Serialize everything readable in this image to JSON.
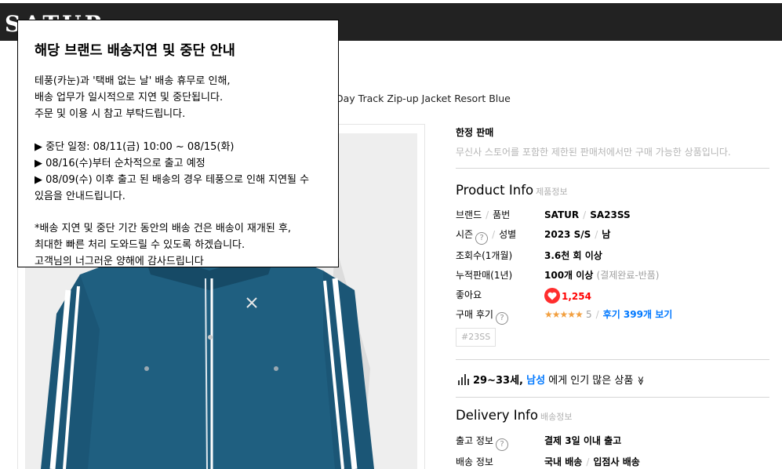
{
  "header": {
    "brand_logo": "SATUR"
  },
  "product": {
    "name": "Day Track Zip-up Jacket Resort Blue"
  },
  "limited": {
    "title": "한정 판매",
    "desc": "무신사 스토어를 포함한 제한된 판매처에서만 구매 가능한 상품입니다."
  },
  "product_info": {
    "title": "Product Info",
    "sub": "제품정보",
    "brand_label": "브랜드",
    "sku_label": "품번",
    "brand_value": "SATUR",
    "sku_value": "SA23SS",
    "season_label": "시즌",
    "gender_label": "성별",
    "season_value": "2023 S/S",
    "gender_value": "남",
    "views_label": "조회수(1개월)",
    "views_value": "3.6천 회 이상",
    "sales_label": "누적판매(1년)",
    "sales_value": "100개 이상",
    "sales_note": "(결제완료-반품)",
    "likes_label": "좋아요",
    "likes_value": "1,254",
    "review_label": "구매 후기",
    "review_stars": "★★★★★",
    "review_score": "5",
    "review_link": "후기 399개 보기",
    "qmark": "?",
    "tag": "#23SS"
  },
  "popular": {
    "age": "29~33세",
    "comma": ",",
    "gender": "남성",
    "text": "에게 인기 많은 상품",
    "chevron": "≫"
  },
  "delivery_info": {
    "title": "Delivery Info",
    "sub": "배송정보",
    "ship_label": "출고 정보",
    "ship_value": "결제 3일 이내 출고",
    "delivery_label": "배송 정보",
    "delivery_value_1": "국내 배송",
    "delivery_value_2": "입점사 배송"
  },
  "notice_modal": {
    "title": "해당 브랜드 배송지연 및 중단 안내",
    "lines": [
      "테풍(카눈)과 '택배 없는 날' 배송 휴무로 인해,",
      "배송 업무가 일시적으로 지연 및 중단됩니다.",
      "주문 및 이용 시 참고 부탁드립니다.",
      "▶ 중단 일정: 08/11(금) 10:00 ~ 08/15(화)",
      "▶ 08/16(수)부터 순차적으로 출고 예정",
      "▶ 08/09(수) 이후 출고 된 배송의 경우 테풍으로 인해 지연될 수",
      "있음을 안내드립니다.",
      "*배송 지연 및 중단 기간 동안의 배송 건은 배송이 재개된 후,",
      "최대한 빠른 처리 도와드릴 수 있도록 하겠습니다.",
      "고객님의 너그러운 양해에 감사드립니다"
    ]
  }
}
